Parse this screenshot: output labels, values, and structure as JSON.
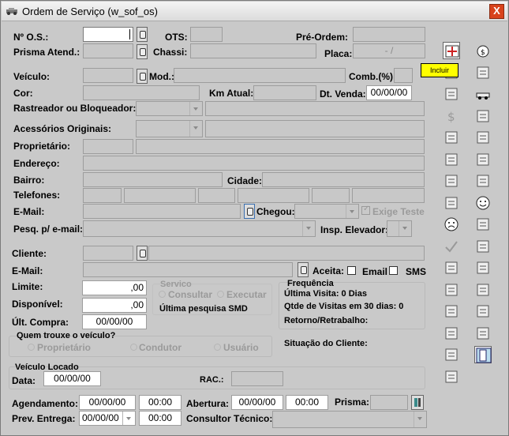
{
  "window": {
    "title": "Ordem de Serviço (w_sof_os)",
    "close_label": "X"
  },
  "labels": {
    "nos": "Nº O.S.:",
    "ots": "OTS:",
    "pre_ordem": "Pré-Ordem:",
    "prisma_atend": "Prisma Atend.:",
    "chassi": "Chassi:",
    "placa": "Placa:",
    "veiculo": "Veículo:",
    "mod": "Mod.:",
    "comb": "Comb.(%):",
    "cor": "Cor:",
    "km_atual": "Km Atual:",
    "dt_venda": "Dt. Venda:",
    "rastreador": "Rastreador ou Bloqueador:",
    "acessorios": "Acessórios Originais:",
    "proprietario": "Proprietário:",
    "endereco": "Endereço:",
    "bairro": "Bairro:",
    "cidade": "Cidade:",
    "telefones": "Telefones:",
    "email": "E-Mail:",
    "chegou": "Chegou:",
    "exige_teste": "Exige Teste",
    "pesq_email": "Pesq. p/ e-mail:",
    "insp_elevador": "Insp. Elevador:",
    "cliente": "Cliente:",
    "email2": "E-Mail:",
    "aceita": "Aceita:",
    "email_opt": "Email",
    "sms_opt": "SMS",
    "limite": "Limite:",
    "disponivel": "Disponível:",
    "ult_compra": "Últ. Compra:",
    "servico": "Servico",
    "consultar": "Consultar",
    "executar": "Executar",
    "ultima_pesquisa": "Última pesquisa SMD",
    "frequencia": "Frequência",
    "ultima_visita": "Última Visita: 0 Dias",
    "qtde_visitas": "Qtde de Visitas em 30 dias: 0",
    "retorno": "Retorno/Retrabalho:",
    "quem_trouxe": "Quem trouxe o veículo?",
    "proprietario_opt": "Proprietário",
    "condutor_opt": "Condutor",
    "usuario_opt": "Usuário",
    "situacao": "Situação do Cliente:",
    "veiculo_locado": "Veículo Locado",
    "data": "Data:",
    "rac": "RAC.:",
    "agendamento": "Agendamento:",
    "abertura": "Abertura:",
    "prisma": "Prisma:",
    "prev_entrega": "Prev. Entrega:",
    "consultor": "Consultor Técnico:"
  },
  "values": {
    "placa": "-   /",
    "dt_venda": "00/00/00",
    "limite": ",00",
    "disponivel": ",00",
    "ult_compra": "00/00/00",
    "data_locado": "00/00/00",
    "agend_date": "00/00/00",
    "agend_time": "00:00",
    "abertura_date": "00/00/00",
    "abertura_time": "00:00",
    "prev_date": "00/00/00",
    "prev_time": "00:00"
  },
  "tooltip": {
    "text": "Incluir"
  },
  "toolbar_icons": [
    "incluir-icon",
    "money-bag-icon",
    "refresh-icon",
    "copy-pages-icon",
    "document-search-icon",
    "car-icon",
    "dollar-icon",
    "tools-icon",
    "document-flow-icon",
    "copy-icon",
    "phone-book-icon",
    "clipboard-icon",
    "factory-icon",
    "wheel-icon",
    "list-icon",
    "smile-icon",
    "sad-face-icon",
    "tap-icon",
    "check-icon",
    "document-stack-icon",
    "camera-icon",
    "printed-doc-icon",
    "printer-icon",
    "mechanic-icon",
    "cow-icon",
    "person-icon",
    "refresh-icon-2",
    "truck-icon",
    "tools-icon-2",
    "exit-door-icon",
    "user-icon"
  ],
  "colors": {
    "background": "#c9c9c9",
    "tooltip": "#ffff00",
    "close": "#d8431c"
  }
}
